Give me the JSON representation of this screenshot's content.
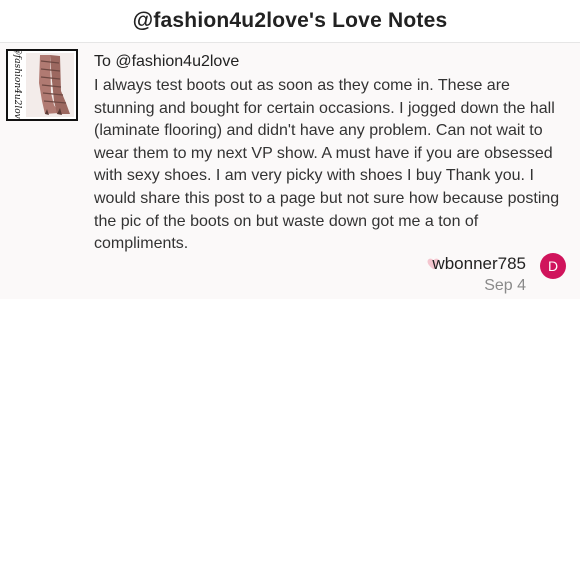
{
  "header": {
    "title": "@fashion4u2love's Love Notes"
  },
  "note": {
    "thumbnail": {
      "watermark": "@fashion4u2love",
      "icon": "boots-photo"
    },
    "to": "To @fashion4u2love",
    "message": "I always test boots out as soon as they come in. These are stunning and bought for certain occasions. I jogged down the hall (laminate flooring) and didn't have any problem. Can not wait to wear them to my next VP show. A must have if you are obsessed with sexy shoes. I am very picky with shoes I buy Thank you. I would share this post to a page but not sure how because posting the pic of the boots on but waste down got me a ton of compliments.",
    "author": {
      "username": "wbonner785",
      "avatar_letter": "D",
      "avatar_color": "#d0145c",
      "heart_icon": "heart-icon",
      "heart_color": "#f4c6cf"
    },
    "date": "Sep 4"
  }
}
